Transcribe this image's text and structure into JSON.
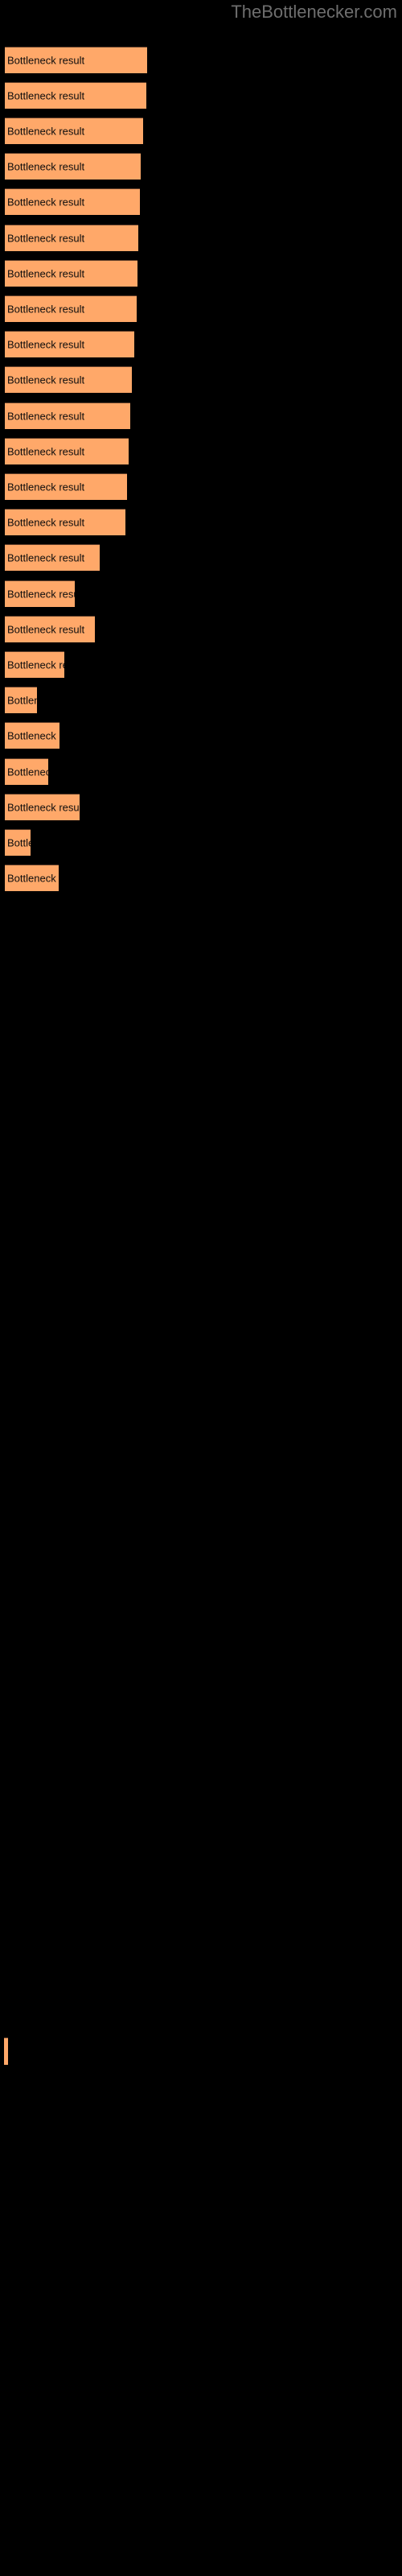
{
  "header": {
    "site_title": "TheBottlenecker.com",
    "title_color": "#6e6e6e"
  },
  "legend": {
    "swatch_name": "bottleneck-result-swatch",
    "swatch_color": "#ffa869"
  },
  "chart_data": {
    "type": "bar",
    "orientation": "horizontal",
    "title": "TheBottlenecker.com",
    "xlabel": "",
    "ylabel": "",
    "grid": false,
    "legend_position": "bottom-left",
    "bar_color": "#ffa869",
    "bar_border_color": "#63402a",
    "background": "#000000",
    "label_text": "Bottleneck result",
    "categories": [
      "",
      "",
      "",
      "",
      "",
      "",
      "",
      "",
      "",
      "",
      "",
      "",
      "",
      "",
      "",
      "",
      "",
      "",
      "",
      "",
      "",
      "",
      "",
      ""
    ],
    "series": [
      {
        "name": "Bottleneck result",
        "values": [
          177,
          176,
          172,
          169,
          168,
          166,
          165,
          164,
          161,
          158,
          156,
          154,
          152,
          150,
          118,
          87,
          112,
          74,
          40,
          68,
          54,
          93,
          32,
          67
        ]
      }
    ],
    "xlim": [
      0,
      177
    ],
    "bars": [
      {
        "label": "Bottleneck result",
        "width": 177,
        "top": 58
      },
      {
        "label": "Bottleneck result",
        "width": 176,
        "top": 102
      },
      {
        "label": "Bottleneck result",
        "width": 172,
        "top": 146
      },
      {
        "label": "Bottleneck result",
        "width": 169,
        "top": 190
      },
      {
        "label": "Bottleneck result",
        "width": 168,
        "top": 234
      },
      {
        "label": "Bottleneck result",
        "width": 166,
        "top": 279
      },
      {
        "label": "Bottleneck result",
        "width": 165,
        "top": 323
      },
      {
        "label": "Bottleneck result",
        "width": 164,
        "top": 367
      },
      {
        "label": "Bottleneck result",
        "width": 161,
        "top": 411
      },
      {
        "label": "Bottleneck result",
        "width": 158,
        "top": 455
      },
      {
        "label": "Bottleneck result",
        "width": 156,
        "top": 500
      },
      {
        "label": "Bottleneck result",
        "width": 154,
        "top": 544
      },
      {
        "label": "Bottleneck result",
        "width": 152,
        "top": 588
      },
      {
        "label": "Bottleneck result",
        "width": 150,
        "top": 632
      },
      {
        "label": "Bottleneck result",
        "width": 118,
        "top": 676
      },
      {
        "label": "Bottleneck result",
        "width": 87,
        "top": 721
      },
      {
        "label": "Bottleneck result",
        "width": 112,
        "top": 765
      },
      {
        "label": "Bottleneck result",
        "width": 74,
        "top": 809
      },
      {
        "label": "Bottleneck result",
        "width": 40,
        "top": 853
      },
      {
        "label": "Bottleneck result",
        "width": 68,
        "top": 897
      },
      {
        "label": "Bottleneck result",
        "width": 54,
        "top": 942
      },
      {
        "label": "Bottleneck result",
        "width": 93,
        "top": 986
      },
      {
        "label": "Bottleneck result",
        "width": 32,
        "top": 1030
      },
      {
        "label": "Bottleneck result",
        "width": 67,
        "top": 1074
      }
    ]
  }
}
